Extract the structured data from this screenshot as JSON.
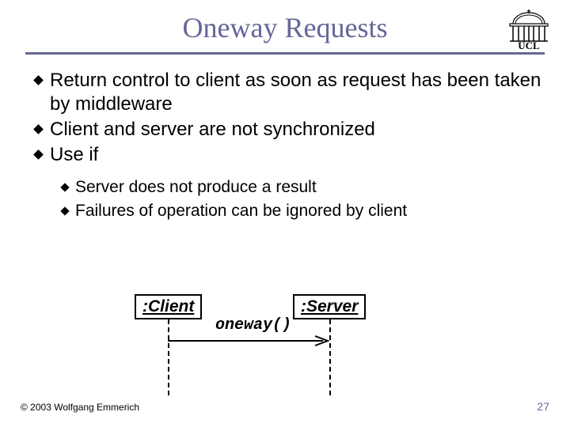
{
  "title": "Oneway Requests",
  "logo": {
    "label": "UCL"
  },
  "bullets": [
    {
      "level": 1,
      "text": "Return control to client as soon as request has been taken by middleware"
    },
    {
      "level": 1,
      "text": "Client and server are not synchronized"
    },
    {
      "level": 1,
      "text": "Use if"
    },
    {
      "level": 2,
      "text": "Server does not produce a result"
    },
    {
      "level": 2,
      "text": "Failures of operation can be ignored by client"
    }
  ],
  "diagram": {
    "client_label": ":Client",
    "server_label": ":Server",
    "message": "oneway()"
  },
  "footer": {
    "copyright": "© 2003 Wolfgang Emmerich",
    "page_number": "27"
  },
  "colors": {
    "heading": "#666699"
  }
}
